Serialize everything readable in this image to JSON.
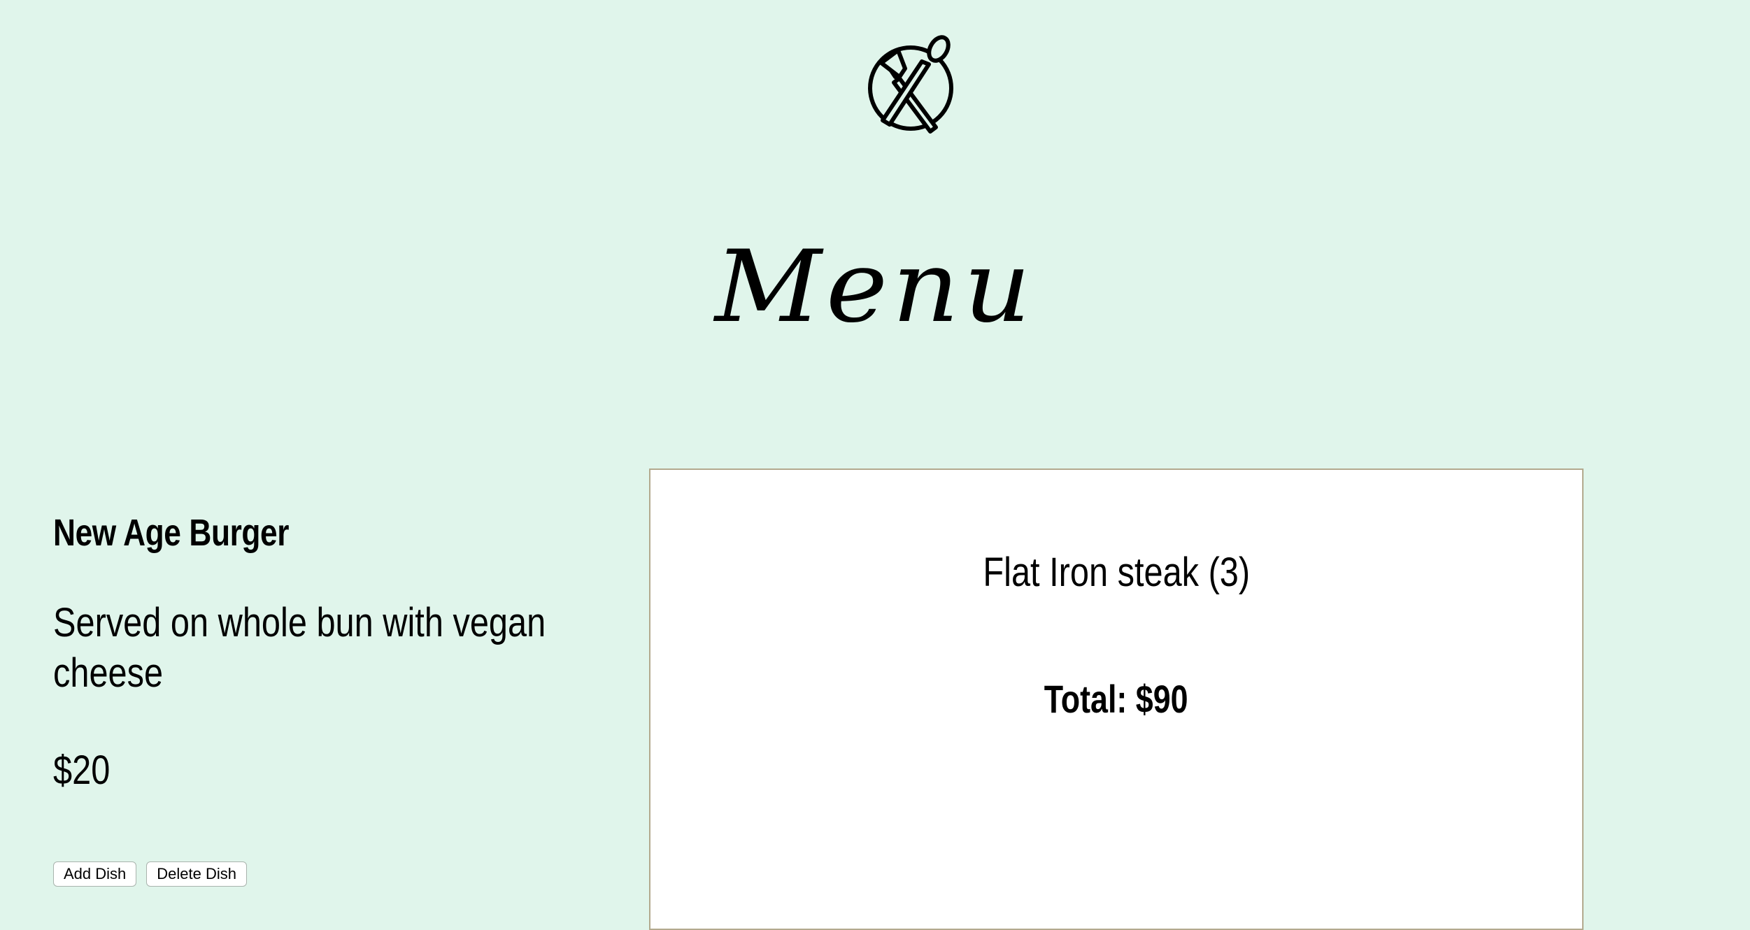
{
  "header": {
    "logo_icon": "plate-fork-spoon-icon",
    "title": "Menu"
  },
  "dish": {
    "name": "New Age Burger",
    "description": "Served on whole bun with vegan cheese",
    "price": "$20",
    "add_label": "Add Dish",
    "delete_label": "Delete Dish"
  },
  "order": {
    "item": "Flat Iron steak (3)",
    "total": "Total: $90"
  },
  "colors": {
    "background": "#e0f5eb",
    "panel": "#ffffff",
    "panel_border": "#b3a98e"
  }
}
